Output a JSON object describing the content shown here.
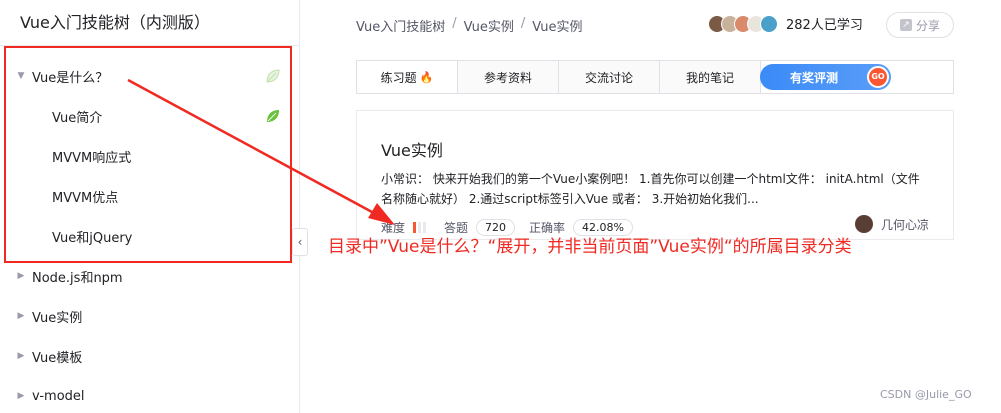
{
  "sidebar": {
    "title": "Vue入门技能树（内测版）",
    "items": [
      {
        "label": "Vue是什么？",
        "level": 0,
        "expanded": true,
        "completed": false,
        "caret": "▼"
      },
      {
        "label": "Vue简介",
        "level": 1,
        "completed": true
      },
      {
        "label": "MVVM响应式",
        "level": 1,
        "completed": false
      },
      {
        "label": "MVVM优点",
        "level": 1,
        "completed": false
      },
      {
        "label": "Vue和jQuery",
        "level": 1,
        "completed": false
      },
      {
        "label": "Node.js和npm",
        "level": 0,
        "expanded": false,
        "caret": "▶"
      },
      {
        "label": "Vue实例",
        "level": 0,
        "expanded": false,
        "caret": "▶"
      },
      {
        "label": "Vue模板",
        "level": 0,
        "expanded": false,
        "caret": "▶"
      },
      {
        "label": "v-model",
        "level": 0,
        "expanded": false,
        "caret": "▶"
      }
    ],
    "collapse_icon": "‹"
  },
  "header": {
    "breadcrumb": [
      "Vue入门技能树",
      "Vue实例",
      "Vue实例"
    ],
    "separator": "/",
    "learner_count": "282人已学习",
    "share_label": "分享"
  },
  "tabs": [
    {
      "label": "练习题",
      "active": true,
      "icon": "🔥"
    },
    {
      "label": "参考资料",
      "active": false
    },
    {
      "label": "交流讨论",
      "active": false
    },
    {
      "label": "我的笔记",
      "active": false
    }
  ],
  "reward": {
    "label": "有奖评测",
    "go": "GO"
  },
  "card": {
    "title": "Vue实例",
    "description": "小常识： 快来开始我们的第一个Vue小案例吧！ 1.首先你可以创建一个html文件： initA.html（文件名称随心就好） 2.通过script标签引入Vue 或者： 3.开始初始化我们...",
    "difficulty_label": "难度",
    "difficulty_level": 1,
    "difficulty_max": 3,
    "answers_label": "答题",
    "answers_count": "720",
    "accuracy_label": "正确率",
    "accuracy_value": "42.08%",
    "author": "几何心凉"
  },
  "annotation": {
    "text": "目录中”Vue是什么？“展开，并非当前页面”Vue实例“的所属目录分类"
  },
  "watermark": "CSDN @Julie_GO",
  "colors": {
    "accent_red": "#f02a22",
    "completed_green": "#67c23a",
    "reward_blue": "#3a8bf7",
    "fire_orange": "#fc5531"
  }
}
